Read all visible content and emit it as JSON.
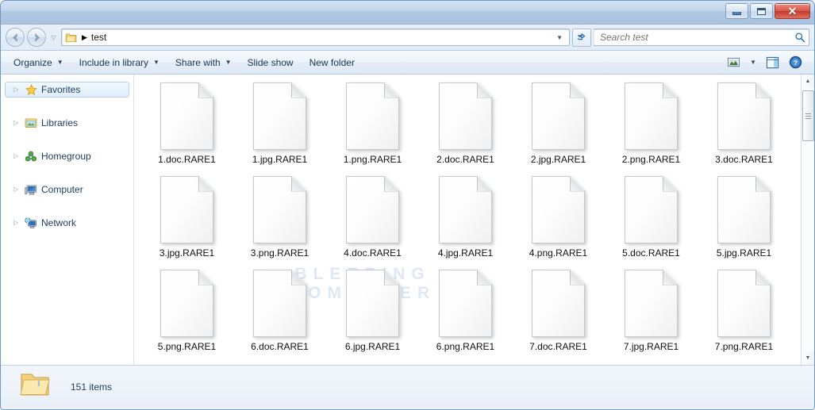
{
  "window": {
    "controls": {
      "minimize": "Minimize",
      "maximize": "Maximize",
      "close": "✕"
    }
  },
  "address": {
    "back_label": "Back",
    "forward_label": "Forward",
    "recent_pages_label": "Recent pages",
    "folder_icon": "folder-icon",
    "separator": "▶",
    "path": "test",
    "dropdown": "▼",
    "refresh_label": "Refresh"
  },
  "search": {
    "placeholder": "Search test",
    "value": "",
    "icon": "search-icon"
  },
  "toolbar": {
    "items": [
      {
        "label": "Organize",
        "caret": "▼"
      },
      {
        "label": "Include in library",
        "caret": "▼"
      },
      {
        "label": "Share with",
        "caret": "▼"
      },
      {
        "label": "Slide show",
        "caret": ""
      },
      {
        "label": "New folder",
        "caret": ""
      }
    ],
    "view_icon": "views-icon",
    "view_caret": "▼",
    "preview_pane_icon": "preview-pane-icon",
    "help_icon": "help-icon",
    "help_glyph": "?"
  },
  "sidebar": {
    "items": [
      {
        "label": "Favorites",
        "icon": "star-icon",
        "caret": "▷",
        "selected": true
      },
      {
        "label": "Libraries",
        "icon": "libraries-icon",
        "caret": "▷",
        "selected": false
      },
      {
        "label": "Homegroup",
        "icon": "homegroup-icon",
        "caret": "▷",
        "selected": false
      },
      {
        "label": "Computer",
        "icon": "computer-icon",
        "caret": "▷",
        "selected": false
      },
      {
        "label": "Network",
        "icon": "network-icon",
        "caret": "▷",
        "selected": false
      }
    ]
  },
  "content": {
    "watermark_line1": "BLEEPING",
    "watermark_line2": "COMPUTER",
    "files": [
      {
        "name": "1.doc.RARE1"
      },
      {
        "name": "1.jpg.RARE1"
      },
      {
        "name": "1.png.RARE1"
      },
      {
        "name": "2.doc.RARE1"
      },
      {
        "name": "2.jpg.RARE1"
      },
      {
        "name": "2.png.RARE1"
      },
      {
        "name": "3.doc.RARE1"
      },
      {
        "name": "3.jpg.RARE1"
      },
      {
        "name": "3.png.RARE1"
      },
      {
        "name": "4.doc.RARE1"
      },
      {
        "name": "4.jpg.RARE1"
      },
      {
        "name": "4.png.RARE1"
      },
      {
        "name": "5.doc.RARE1"
      },
      {
        "name": "5.jpg.RARE1"
      },
      {
        "name": "5.png.RARE1"
      },
      {
        "name": "6.doc.RARE1"
      },
      {
        "name": "6.jpg.RARE1"
      },
      {
        "name": "6.png.RARE1"
      },
      {
        "name": "7.doc.RARE1"
      },
      {
        "name": "7.jpg.RARE1"
      },
      {
        "name": "7.png.RARE1"
      }
    ]
  },
  "scrollbar": {
    "up_arrow": "▲",
    "down_arrow": "▼"
  },
  "statusbar": {
    "folder_icon": "folder-icon",
    "item_count": "151 items"
  },
  "colors": {
    "accent": "#a9c2de",
    "close_button": "#c23a2c",
    "selection": "#e0edfa",
    "watermark": "#dde8f4"
  }
}
